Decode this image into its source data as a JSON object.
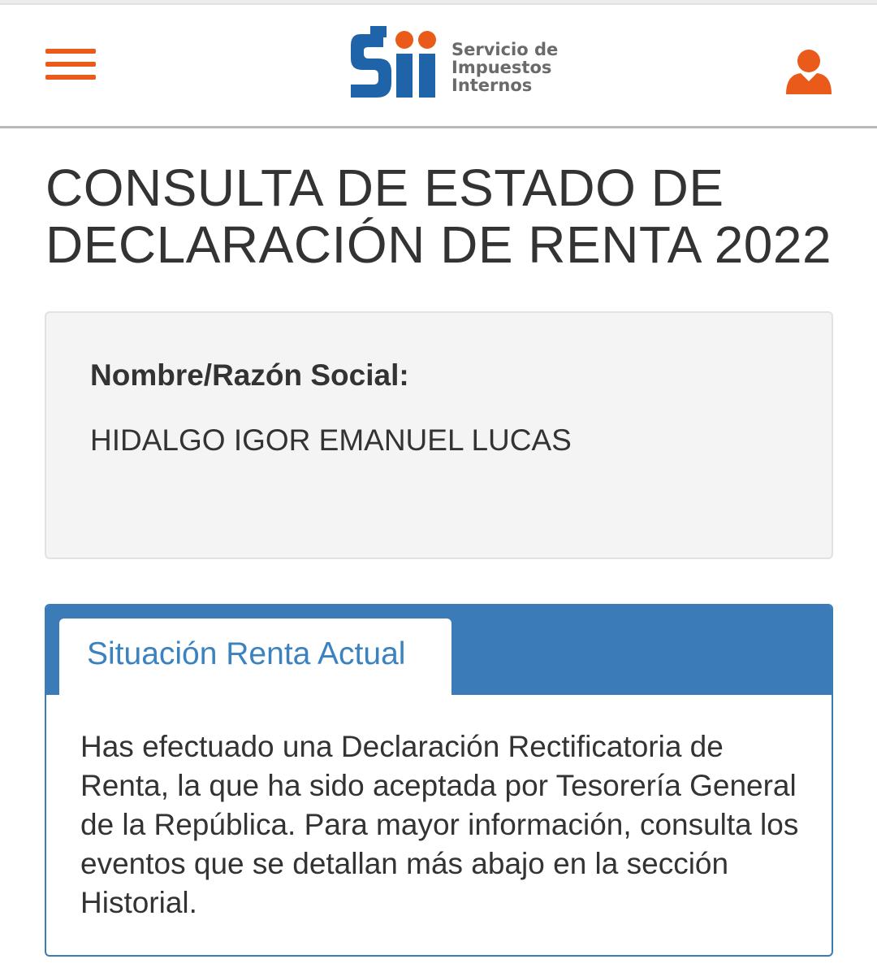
{
  "colors": {
    "accent": "#ea5a1a",
    "primary_blue": "#3b7cb8",
    "logo_blue": "#1f63a8",
    "logo_orange": "#ea5a1a"
  },
  "header": {
    "menu_icon": "hamburger-menu-icon",
    "logo": {
      "text_line1": "Servicio de",
      "text_line2": "Impuestos",
      "text_line3": "Internos",
      "mark": "Sii"
    },
    "user_icon": "user-icon"
  },
  "page": {
    "title_line1": "CONSULTA DE ESTADO DE",
    "title_line2": "DECLARACIÓN DE RENTA 2022"
  },
  "taxpayer": {
    "label": "Nombre/Razón Social:",
    "name": "HIDALGO IGOR EMANUEL LUCAS"
  },
  "status": {
    "tab_label": "Situación Renta Actual",
    "message": "Has efectuado una Declaración Rectificatoria de Renta, la que ha sido aceptada por Tesorería General de la República. Para mayor información, consulta los eventos que se detallan más abajo en la sección Historial."
  }
}
